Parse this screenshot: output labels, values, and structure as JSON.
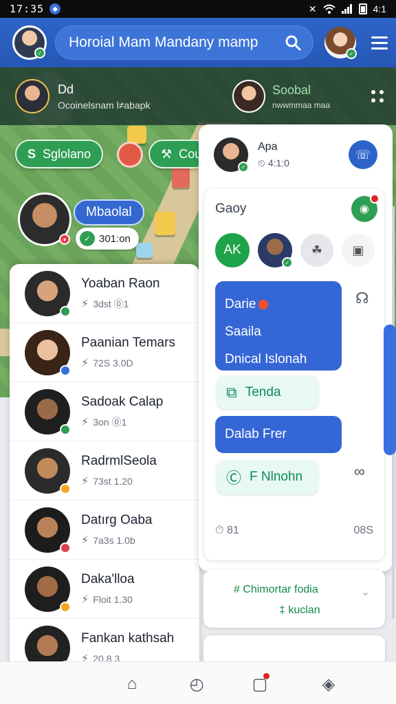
{
  "status_bar": {
    "time": "17:35",
    "right_text": "4:1",
    "icons": [
      "app-icon",
      "mute-icon",
      "wifi-icon",
      "signal-icon",
      "battery-icon"
    ]
  },
  "header": {
    "search_text": "Horoial Mam Mandany mamp",
    "icons": [
      "avatar",
      "search-icon",
      "avatar",
      "menu-icon"
    ]
  },
  "activity": {
    "left_name": "Dd",
    "left_sub": "Ocoinelsnam l≠abapk",
    "right_name": "Soobal",
    "right_sub": "nwwmmaa maa"
  },
  "map": {
    "chip_left": "Sglolano",
    "chip_right": "Coulka",
    "player_name": "Mbaolal",
    "player_status": "301:on"
  },
  "contacts": [
    {
      "name": "Yoaban Raon",
      "meta": "3dst ⓪1",
      "badge": "#2f9e55",
      "skin": "#d6a37c",
      "hair": "#2a2a2a"
    },
    {
      "name": "Paanian Temars",
      "meta": "72S 3.0D",
      "badge": "#3b6fd9",
      "skin": "#e9c19f",
      "hair": "#3a2418"
    },
    {
      "name": "Sadoak Calap",
      "meta": "3on ⓪1",
      "badge": "#2f9e55",
      "skin": "#9a6a48",
      "hair": "#1f1f1f"
    },
    {
      "name": "RadrmlSeola",
      "meta": "73st 1.20",
      "badge": "#f4a623",
      "skin": "#c18a5b",
      "hair": "#2b2b2b"
    },
    {
      "name": "Datırg Oaba",
      "meta": "7a3s 1.0b",
      "badge": "#e0414d",
      "skin": "#b98159",
      "hair": "#1c1c1c"
    },
    {
      "name": "Daka'lloa",
      "meta": "Floit 1.30",
      "badge": "#f4a623",
      "skin": "#a06b45",
      "hair": "#1e1e1e"
    },
    {
      "name": "Fankan kathsah",
      "meta": "20.8 3",
      "badge": "#e0414d",
      "skin": "#b27a52",
      "hair": "#222222"
    }
  ],
  "chat": {
    "contact_name": "Apa",
    "contact_time": "4:1:0",
    "section_title": "Gaoy",
    "avatar_initials": "AK",
    "bubble_1": [
      "Darie",
      "Saaila",
      "Dnical Islonah"
    ],
    "mint_1": "Tenda",
    "bubble_2": "Dalab Frer",
    "mint_2": "F Nlnohn",
    "footer_left": "81",
    "footer_right": "08S"
  },
  "card2": {
    "line1": "# Chimortar fodia",
    "line2": "‡ kuclan"
  },
  "colors": {
    "brand_blue": "#2f64c7",
    "accent_green": "#2f9e55",
    "bubble_blue": "#3566d6"
  }
}
